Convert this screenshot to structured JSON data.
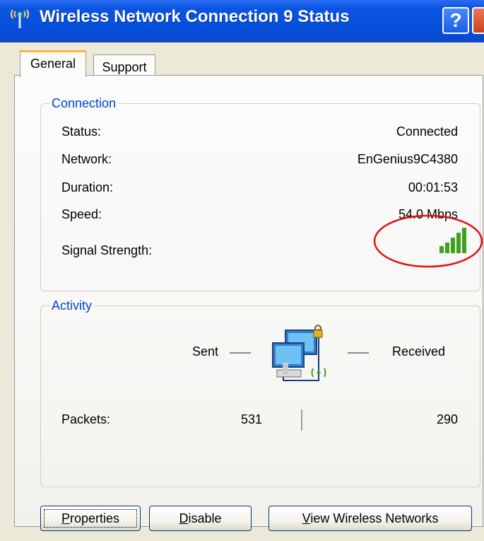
{
  "window": {
    "title": "Wireless Network Connection 9 Status",
    "help_label": "?"
  },
  "tabs": [
    {
      "label": "General",
      "selected": true
    },
    {
      "label": "Support",
      "selected": false
    }
  ],
  "connection": {
    "legend": "Connection",
    "status_label": "Status:",
    "status_value": "Connected",
    "network_label": "Network:",
    "network_value": "EnGenius9C4380",
    "duration_label": "Duration:",
    "duration_value": "00:01:53",
    "speed_label": "Speed:",
    "speed_value": "54.0 Mbps",
    "signal_label": "Signal Strength:",
    "signal_bars_lit": 5,
    "signal_bars_total": 5
  },
  "activity": {
    "legend": "Activity",
    "sent_label": "Sent",
    "received_label": "Received",
    "packets_label": "Packets:",
    "packets_sent": "531",
    "packets_received": "290"
  },
  "buttons": {
    "properties_mnemonic": "P",
    "properties_rest": "roperties",
    "disable_mnemonic": "D",
    "disable_rest": "isable",
    "view_mnemonic": "V",
    "view_rest": "iew Wireless Networks"
  },
  "colors": {
    "accent": "#0046d5",
    "signal_green": "#3fa11c",
    "annotation_red": "#e01010"
  }
}
